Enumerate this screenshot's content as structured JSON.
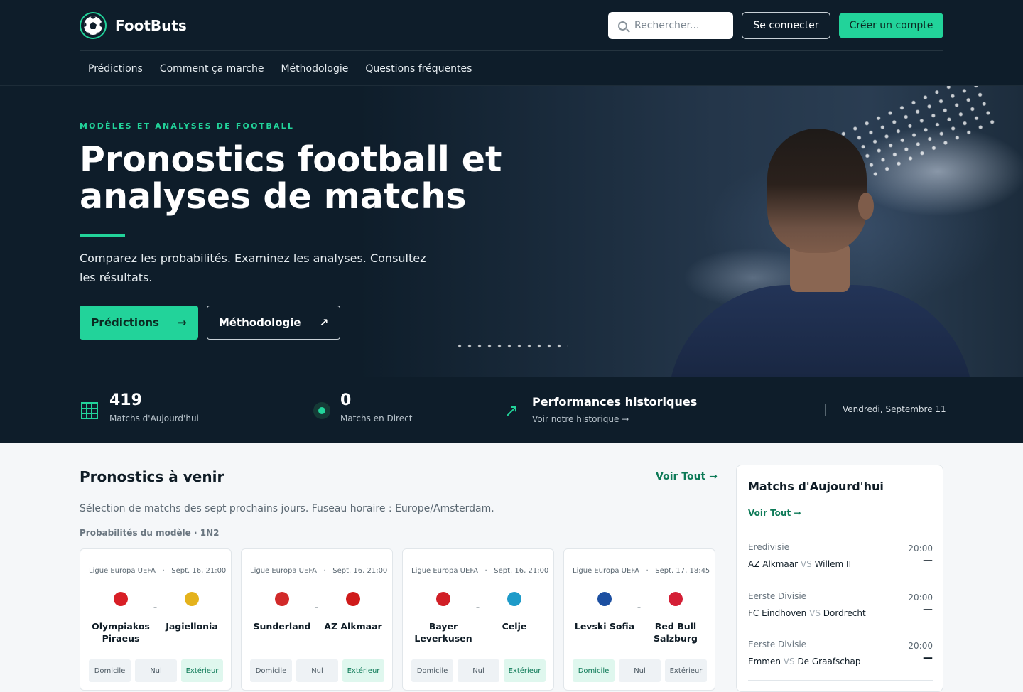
{
  "header": {
    "logo_text": "FootButs",
    "search_placeholder": "Rechercher...",
    "login_label": "Se connecter",
    "register_label": "Créer un compte",
    "nav": [
      "Prédictions",
      "Comment ça marche",
      "Méthodologie",
      "Questions fréquentes"
    ]
  },
  "hero": {
    "eyebrow": "MODÈLES ET ANALYSES DE FOOTBALL",
    "title": "Pronostics football et analyses de matchs",
    "subtitle": "Comparez les probabilités. Examinez les analyses. Consultez les résultats.",
    "btn_predictions": "Prédictions",
    "btn_predictions_arrow": "→",
    "btn_methodology": "Méthodologie",
    "btn_methodology_arrow": "↗"
  },
  "stats": {
    "today_count": "419",
    "today_label": "Matchs d'Aujourd'hui",
    "live_count": "0",
    "live_label": "Matchs en Direct",
    "history_title": "Performances historiques",
    "history_link": "Voir notre historique →",
    "date": "Vendredi, Septembre 11"
  },
  "upcoming": {
    "title": "Pronostics à venir",
    "see_all": "Voir Tout →",
    "subtitle": "Sélection de matchs des sept prochains jours. Fuseau horaire : Europe/Amsterdam.",
    "meta": "Probabilités du modèle · 1N2",
    "odds_labels": [
      "Domicile",
      "Nul",
      "Extérieur"
    ],
    "cards": [
      {
        "competition": "Ligue Europa UEFA",
        "date": "Sept. 16, 21:00",
        "home": "Olympiakos Piraeus",
        "away": "Jagiellonia",
        "highlight": 2,
        "home_color": "#d81f26",
        "away_color": "#e4b21c"
      },
      {
        "competition": "Ligue Europa UEFA",
        "date": "Sept. 16, 21:00",
        "home": "Sunderland",
        "away": "AZ Alkmaar",
        "highlight": 2,
        "home_color": "#d12a2a",
        "away_color": "#cf1a1a"
      },
      {
        "competition": "Ligue Europa UEFA",
        "date": "Sept. 16, 21:00",
        "home": "Bayer Leverkusen",
        "away": "Celje",
        "highlight": 2,
        "home_color": "#d11f26",
        "away_color": "#1e9bc9"
      },
      {
        "competition": "Ligue Europa UEFA",
        "date": "Sept. 17, 18:45",
        "home": "Levski Sofia",
        "away": "Red Bull Salzburg",
        "highlight": 0,
        "home_color": "#1c4fa1",
        "away_color": "#d41f36"
      }
    ]
  },
  "today": {
    "title": "Matchs d'Aujourd'hui",
    "see_all": "Voir Tout →",
    "vs": "VS",
    "matches": [
      {
        "league": "Eredivisie",
        "time": "20:00",
        "home": "AZ Alkmaar",
        "away": "Willem II",
        "score": "—"
      },
      {
        "league": "Eerste Divisie",
        "time": "20:00",
        "home": "FC Eindhoven",
        "away": "Dordrecht",
        "score": "—"
      },
      {
        "league": "Eerste Divisie",
        "time": "20:00",
        "home": "Emmen",
        "away": "De Graafschap",
        "score": "—"
      }
    ]
  }
}
